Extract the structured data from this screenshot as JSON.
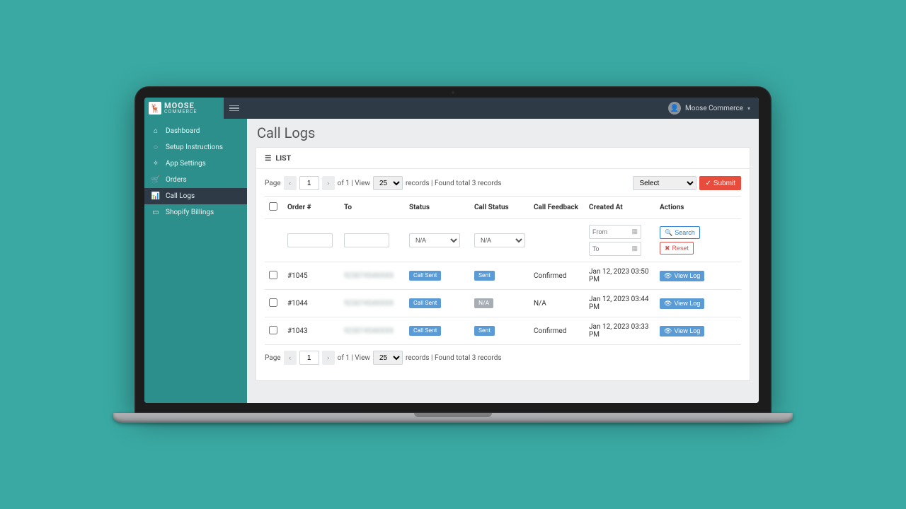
{
  "brand": {
    "line1": "MOOSE",
    "line2": "COMMERCE",
    "mark": "🦌"
  },
  "user": {
    "name": "Moose Commerce"
  },
  "sidebar": {
    "items": [
      {
        "icon": "⌂",
        "label": "Dashboard",
        "active": false
      },
      {
        "icon": "◌",
        "label": "Setup Instructions",
        "active": false
      },
      {
        "icon": "✧",
        "label": "App Settings",
        "active": false
      },
      {
        "icon": "🛒",
        "label": "Orders",
        "active": false
      },
      {
        "icon": "📊",
        "label": "Call Logs",
        "active": true
      },
      {
        "icon": "▭",
        "label": "Shopify Billings",
        "active": false
      }
    ]
  },
  "page": {
    "title": "Call Logs"
  },
  "panel": {
    "title": "LIST"
  },
  "pagination": {
    "page_label": "Page",
    "current": "1",
    "of_text": "of 1 | View",
    "per_page": "25",
    "records_text": "records | Found total 3 records"
  },
  "bulk": {
    "select_placeholder": "Select",
    "submit_label": "Submit"
  },
  "table": {
    "headers": {
      "order": "Order #",
      "to": "To",
      "status": "Status",
      "call_status": "Call Status",
      "call_feedback": "Call Feedback",
      "created_at": "Created At",
      "actions": "Actions"
    },
    "filters": {
      "status_option": "N/A",
      "call_status_option": "N/A",
      "from_placeholder": "From",
      "to_placeholder": "To",
      "search_label": "Search",
      "reset_label": "Reset"
    },
    "rows": [
      {
        "order": "#1045",
        "to": "92307454XXXX",
        "status": "Call Sent",
        "call_status": "Sent",
        "call_status_style": "blue",
        "feedback": "Confirmed",
        "created": "Jan 12, 2023 03:50 PM",
        "action": "View Log"
      },
      {
        "order": "#1044",
        "to": "92307454XXXX",
        "status": "Call Sent",
        "call_status": "N/A",
        "call_status_style": "grey",
        "feedback": "N/A",
        "created": "Jan 12, 2023 03:44 PM",
        "action": "View Log"
      },
      {
        "order": "#1043",
        "to": "92307454XXXX",
        "status": "Call Sent",
        "call_status": "Sent",
        "call_status_style": "blue",
        "feedback": "Confirmed",
        "created": "Jan 12, 2023 03:33 PM",
        "action": "View Log"
      }
    ]
  }
}
